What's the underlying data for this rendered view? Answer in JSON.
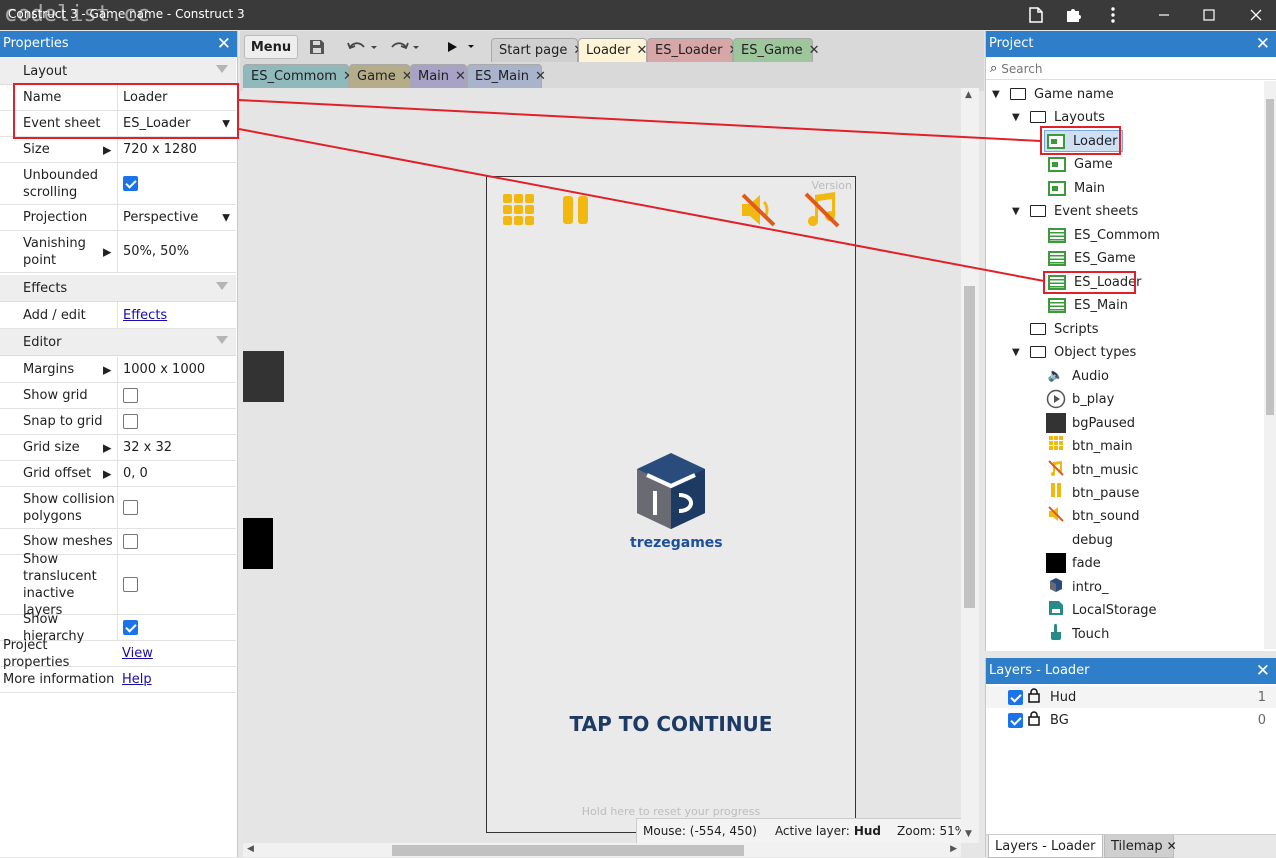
{
  "titlebar": {
    "title": "Construct 3 - Game name - Construct 3",
    "watermark": "codelist.cc"
  },
  "properties": {
    "header": "Properties",
    "layout_section": "Layout",
    "name_label": "Name",
    "name_value": "Loader",
    "event_sheet_label": "Event sheet",
    "event_sheet_value": "ES_Loader",
    "size_label": "Size",
    "size_value": "720 x 1280",
    "unbounded_label": "Unbounded scrolling",
    "unbounded_checked": true,
    "projection_label": "Projection",
    "projection_value": "Perspective",
    "vanishing_label": "Vanishing point",
    "vanishing_value": "50%, 50%",
    "effects_section": "Effects",
    "addedit_label": "Add / edit",
    "addedit_link": "Effects",
    "editor_section": "Editor",
    "margins_label": "Margins",
    "margins_value": "1000 x 1000",
    "showgrid_label": "Show grid",
    "showgrid_checked": false,
    "snap_label": "Snap to grid",
    "snap_checked": false,
    "gridsize_label": "Grid size",
    "gridsize_value": "32 x 32",
    "gridoffset_label": "Grid offset",
    "gridoffset_value": "0, 0",
    "collision_label": "Show collision polygons",
    "collision_checked": false,
    "meshes_label": "Show meshes",
    "meshes_checked": false,
    "translucent_label": "Show translucent inactive layers",
    "translucent_checked": false,
    "hierarchy_label": "Show hierarchy",
    "hierarchy_checked": true,
    "projprops_label": "Project properties",
    "projprops_link": "View",
    "moreinfo_label": "More information",
    "moreinfo_link": "Help"
  },
  "toolbar": {
    "menu_label": "Menu"
  },
  "tabs_row1": [
    "Start page",
    "Loader",
    "ES_Loader",
    "ES_Game"
  ],
  "tabs_row2": [
    "ES_Commom",
    "Game",
    "Main",
    "ES_Main"
  ],
  "layout_view": {
    "version_text": "Version",
    "logo_text": "trezegames",
    "tap_text": "TAP TO CONTINUE",
    "hold_text": "Hold here to reset your progress"
  },
  "status": {
    "mouse_text": "Mouse: (-554, 450)",
    "active_layer_label": "Active layer:",
    "active_layer_value": "Hud",
    "zoom_text": "Zoom: 51%"
  },
  "project": {
    "header": "Project",
    "search_placeholder": "Search",
    "root": "Game name",
    "layouts_folder": "Layouts",
    "layouts": [
      "Loader",
      "Game",
      "Main"
    ],
    "eventsheets_folder": "Event sheets",
    "eventsheets": [
      "ES_Commom",
      "ES_Game",
      "ES_Loader",
      "ES_Main"
    ],
    "scripts_folder": "Scripts",
    "objecttypes_folder": "Object types",
    "objects": [
      "Audio",
      "b_play",
      "bgPaused",
      "btn_main",
      "btn_music",
      "btn_pause",
      "btn_sound",
      "debug",
      "fade",
      "intro_",
      "LocalStorage",
      "Touch"
    ]
  },
  "layers": {
    "header": "Layers - Loader",
    "items": [
      {
        "name": "Hud",
        "index": "1"
      },
      {
        "name": "BG",
        "index": "0"
      }
    ],
    "bottom_tab1": "Layers - Loader",
    "bottom_tab2": "Tilemap"
  },
  "colors": {
    "accent": "#2f7ec9",
    "highlight": "#e0202a",
    "tap_text": "#1c3a63"
  }
}
